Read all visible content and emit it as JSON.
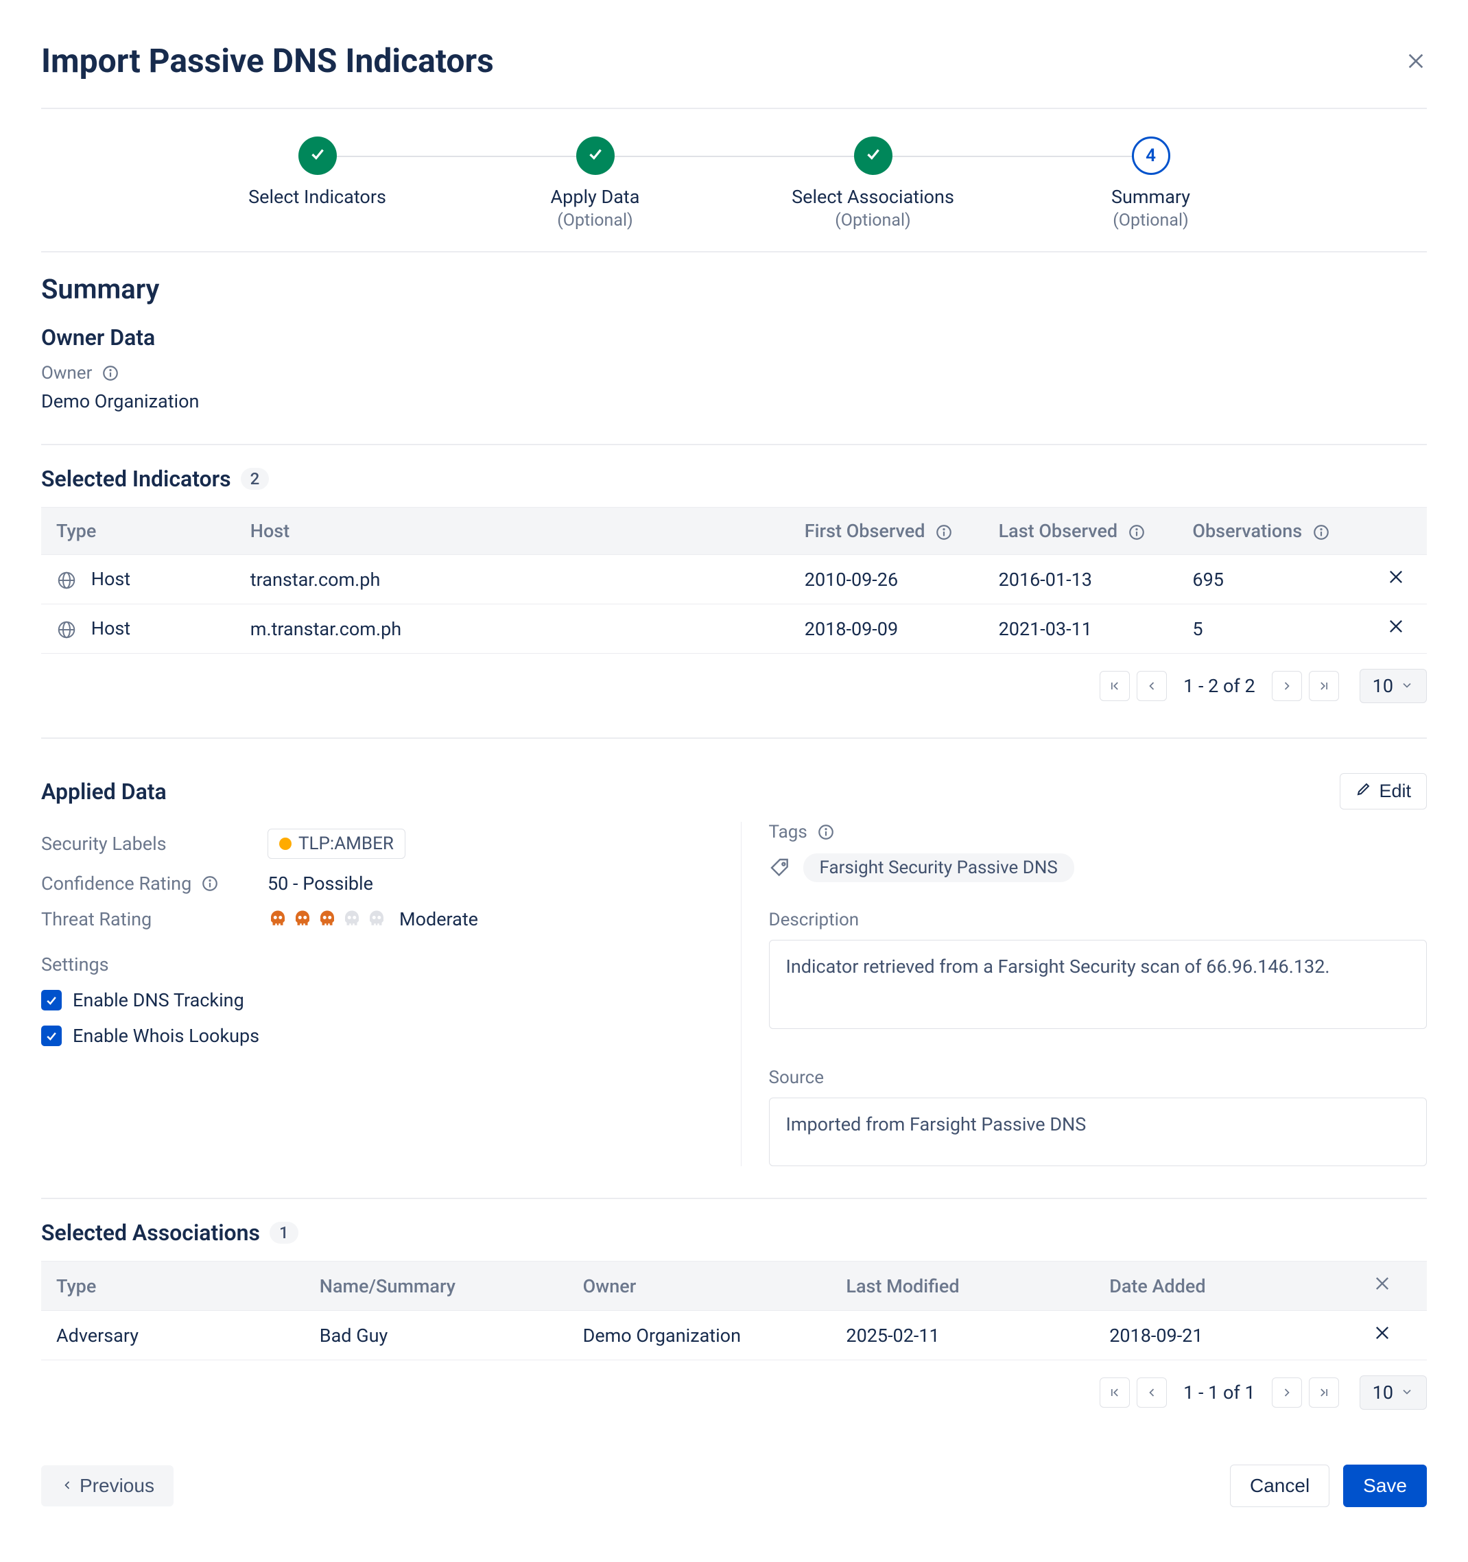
{
  "header": {
    "title": "Import Passive DNS Indicators"
  },
  "stepper": {
    "steps": [
      {
        "label": "Select Indicators",
        "sub": "",
        "state": "done"
      },
      {
        "label": "Apply Data",
        "sub": "(Optional)",
        "state": "done"
      },
      {
        "label": "Select Associations",
        "sub": "(Optional)",
        "state": "done"
      },
      {
        "label": "Summary",
        "sub": "(Optional)",
        "state": "current",
        "number": "4"
      }
    ]
  },
  "summary": {
    "title": "Summary",
    "owner_heading": "Owner Data",
    "owner_label": "Owner",
    "owner_value": "Demo Organization"
  },
  "indicators": {
    "heading": "Selected Indicators",
    "count": "2",
    "columns": {
      "type": "Type",
      "host": "Host",
      "first": "First Observed",
      "last": "Last Observed",
      "obs": "Observations"
    },
    "rows": [
      {
        "type": "Host",
        "host": "transtar.com.ph",
        "first": "2010-09-26",
        "last": "2016-01-13",
        "obs": "695"
      },
      {
        "type": "Host",
        "host": "m.transtar.com.ph",
        "first": "2018-09-09",
        "last": "2021-03-11",
        "obs": "5"
      }
    ],
    "pager": {
      "info": "1 - 2 of 2",
      "page_size": "10"
    }
  },
  "applied": {
    "heading": "Applied Data",
    "edit_label": "Edit",
    "security_labels_label": "Security Labels",
    "security_label_value": "TLP:AMBER",
    "confidence_label": "Confidence Rating",
    "confidence_value": "50 - Possible",
    "threat_label": "Threat Rating",
    "threat_value_text": "Moderate",
    "settings_label": "Settings",
    "setting_dns": "Enable DNS Tracking",
    "setting_whois": "Enable Whois Lookups",
    "tags_label": "Tags",
    "tag_value": "Farsight Security Passive DNS",
    "description_label": "Description",
    "description_value": "Indicator retrieved from a Farsight Security scan of 66.96.146.132.",
    "source_label": "Source",
    "source_value": "Imported from Farsight Passive DNS"
  },
  "associations": {
    "heading": "Selected Associations",
    "count": "1",
    "columns": {
      "type": "Type",
      "name": "Name/Summary",
      "owner": "Owner",
      "modified": "Last Modified",
      "added": "Date Added"
    },
    "rows": [
      {
        "type": "Adversary",
        "name": "Bad Guy",
        "owner": "Demo Organization",
        "modified": "2025-02-11",
        "added": "2018-09-21"
      }
    ],
    "pager": {
      "info": "1 - 1 of 1",
      "page_size": "10"
    }
  },
  "footer": {
    "previous": "Previous",
    "cancel": "Cancel",
    "save": "Save"
  }
}
